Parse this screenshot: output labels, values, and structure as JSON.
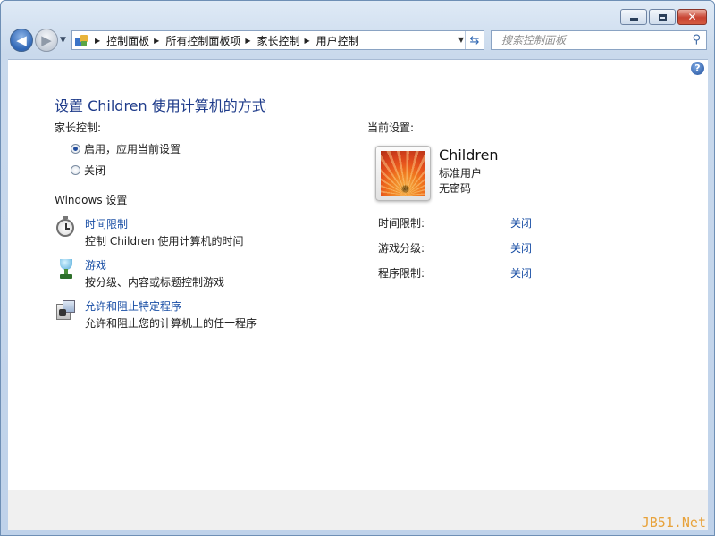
{
  "address_bar": {
    "breadcrumbs": [
      "控制面板",
      "所有控制面板项",
      "家长控制",
      "用户控制"
    ]
  },
  "search": {
    "placeholder": "搜索控制面板"
  },
  "page": {
    "title": "设置 Children 使用计算机的方式",
    "parental_controls_label": "家长控制:",
    "options": [
      {
        "label": "启用，应用当前设置",
        "selected": true
      },
      {
        "label": "关闭",
        "selected": false
      }
    ],
    "windows_settings_label": "Windows 设置",
    "settings_items": [
      {
        "icon": "stopwatch-icon",
        "link": "时间限制",
        "desc": "控制 Children 使用计算机的时间"
      },
      {
        "icon": "trophy-icon",
        "link": "游戏",
        "desc": "按分级、内容或标题控制游戏"
      },
      {
        "icon": "program-icon",
        "link": "允许和阻止特定程序",
        "desc": "允许和阻止您的计算机上的任一程序"
      }
    ]
  },
  "current": {
    "label": "当前设置:",
    "user_name": "Children",
    "role": "标准用户",
    "password": "无密码",
    "settings": [
      {
        "label": "时间限制:",
        "value": "关闭"
      },
      {
        "label": "游戏分级:",
        "value": "关闭"
      },
      {
        "label": "程序限制:",
        "value": "关闭"
      }
    ]
  },
  "watermark": "JB51.Net"
}
